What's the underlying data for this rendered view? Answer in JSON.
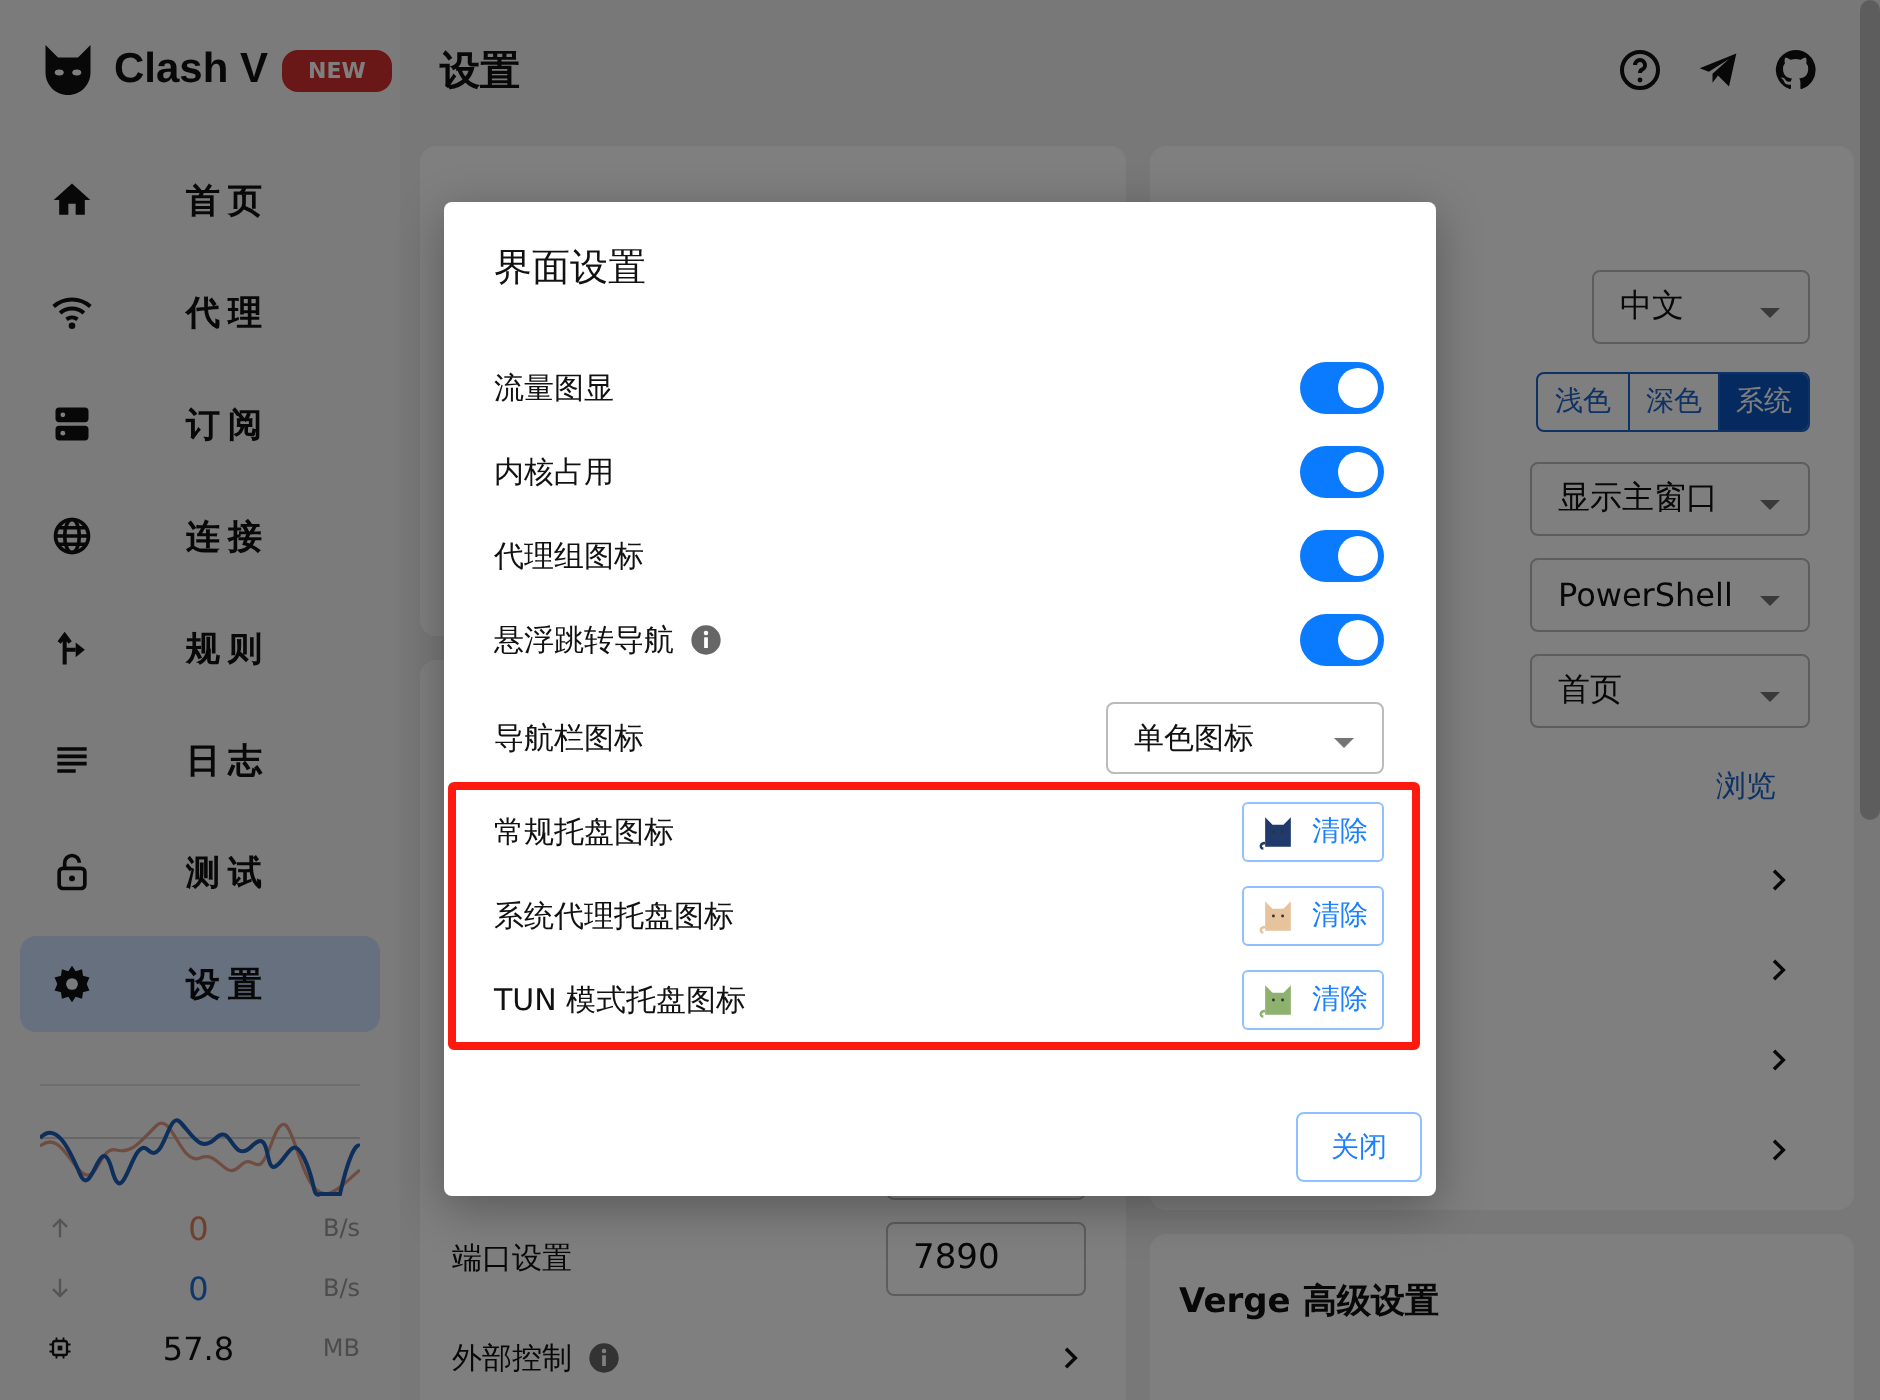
{
  "sidebar": {
    "logo_text": "Clash V",
    "badge": "NEW",
    "nav": [
      {
        "label": "首页",
        "selected": false
      },
      {
        "label": "代理",
        "selected": false
      },
      {
        "label": "订阅",
        "selected": false
      },
      {
        "label": "连接",
        "selected": false
      },
      {
        "label": "规则",
        "selected": false
      },
      {
        "label": "日志",
        "selected": false
      },
      {
        "label": "测试",
        "selected": false
      },
      {
        "label": "设置",
        "selected": true
      }
    ],
    "traffic": {
      "up": "0",
      "up_unit": "B/s",
      "down": "0",
      "down_unit": "B/s",
      "memory": "57.8",
      "memory_unit": "MB"
    }
  },
  "header": {
    "title": "设置"
  },
  "system_card": {
    "rows": [
      {
        "kind": "field"
      },
      {
        "kind": "field",
        "label": "端口设置",
        "value": "7890"
      },
      {
        "kind": "chevron",
        "label": "外部控制",
        "info": true
      }
    ]
  },
  "verge_card": {
    "rows": [
      {
        "kind": "select",
        "value": "中文"
      },
      {
        "kind": "segmented",
        "options": [
          {
            "label": "浅色",
            "selected": false
          },
          {
            "label": "深色",
            "selected": false
          },
          {
            "label": "系统",
            "selected": true
          }
        ]
      },
      {
        "kind": "select",
        "value": "显示主窗口"
      },
      {
        "kind": "select",
        "value": "PowerShell"
      },
      {
        "kind": "select",
        "value": "首页"
      },
      {
        "kind": "link",
        "label": "浏览"
      },
      {
        "kind": "chevron"
      },
      {
        "kind": "chevron"
      },
      {
        "kind": "chevron"
      },
      {
        "kind": "chevron"
      }
    ]
  },
  "advanced_card": {
    "title": "Verge 高级设置"
  },
  "dialog": {
    "title": "界面设置",
    "rows": [
      {
        "kind": "toggle",
        "label": "流量图显",
        "on": true
      },
      {
        "kind": "toggle",
        "label": "内核占用",
        "on": true
      },
      {
        "kind": "toggle",
        "label": "代理组图标",
        "on": true
      },
      {
        "kind": "toggle",
        "label": "悬浮跳转导航",
        "on": true,
        "info": true
      },
      {
        "kind": "select",
        "label": "导航栏图标",
        "value": "单色图标"
      }
    ],
    "highlighted": true,
    "tray_rows": [
      {
        "label": "常规托盘图标",
        "button": "清除",
        "color": "#1f3a6b"
      },
      {
        "label": "系统代理托盘图标",
        "button": "清除",
        "color": "#e6c39c"
      },
      {
        "label": "TUN 模式托盘图标",
        "button": "清除",
        "color": "#8fb16e"
      }
    ],
    "close_button": "关闭"
  }
}
